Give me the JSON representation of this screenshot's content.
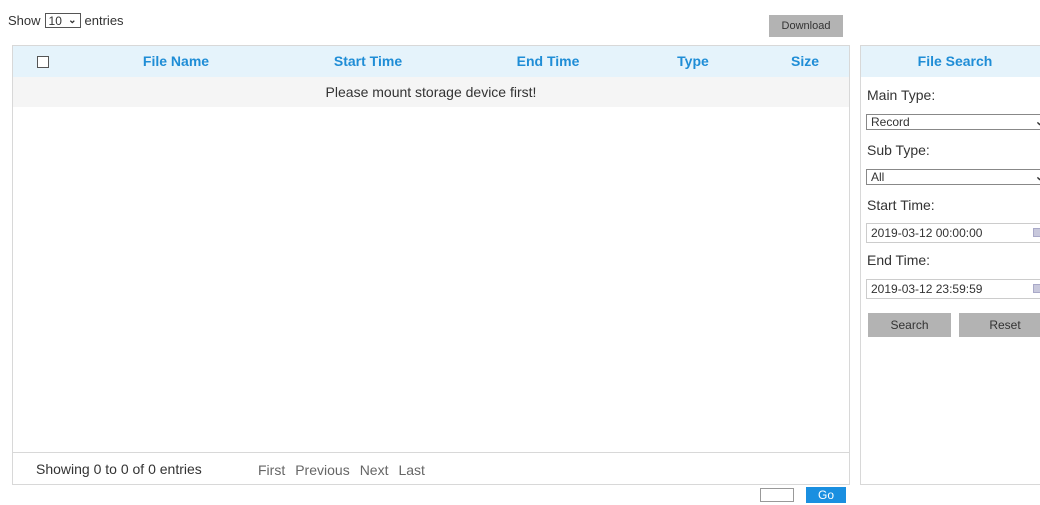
{
  "top": {
    "show_label": "Show",
    "entries_select_value": "10",
    "entries_label": "entries",
    "download_label": "Download"
  },
  "table": {
    "columns": [
      "File Name",
      "Start Time",
      "End Time",
      "Type",
      "Size"
    ],
    "empty_message": "Please mount storage device first!",
    "showing_text": "Showing 0 to 0 of 0 entries",
    "pager": {
      "first": "First",
      "previous": "Previous",
      "next": "Next",
      "last": "Last"
    },
    "go_label": "Go"
  },
  "search": {
    "title": "File Search",
    "main_type_label": "Main Type:",
    "main_type_value": "Record",
    "sub_type_label": "Sub Type:",
    "sub_type_value": "All",
    "start_time_label": "Start Time:",
    "start_time_value": "2019-03-12 00:00:00",
    "end_time_label": "End Time:",
    "end_time_value": "2019-03-12 23:59:59",
    "search_label": "Search",
    "reset_label": "Reset"
  },
  "colors": {
    "header_bg": "#e5f3fb",
    "header_text": "#1f8dd6",
    "go_button": "#1a8fe0",
    "gray_button": "#b3b3b3"
  }
}
